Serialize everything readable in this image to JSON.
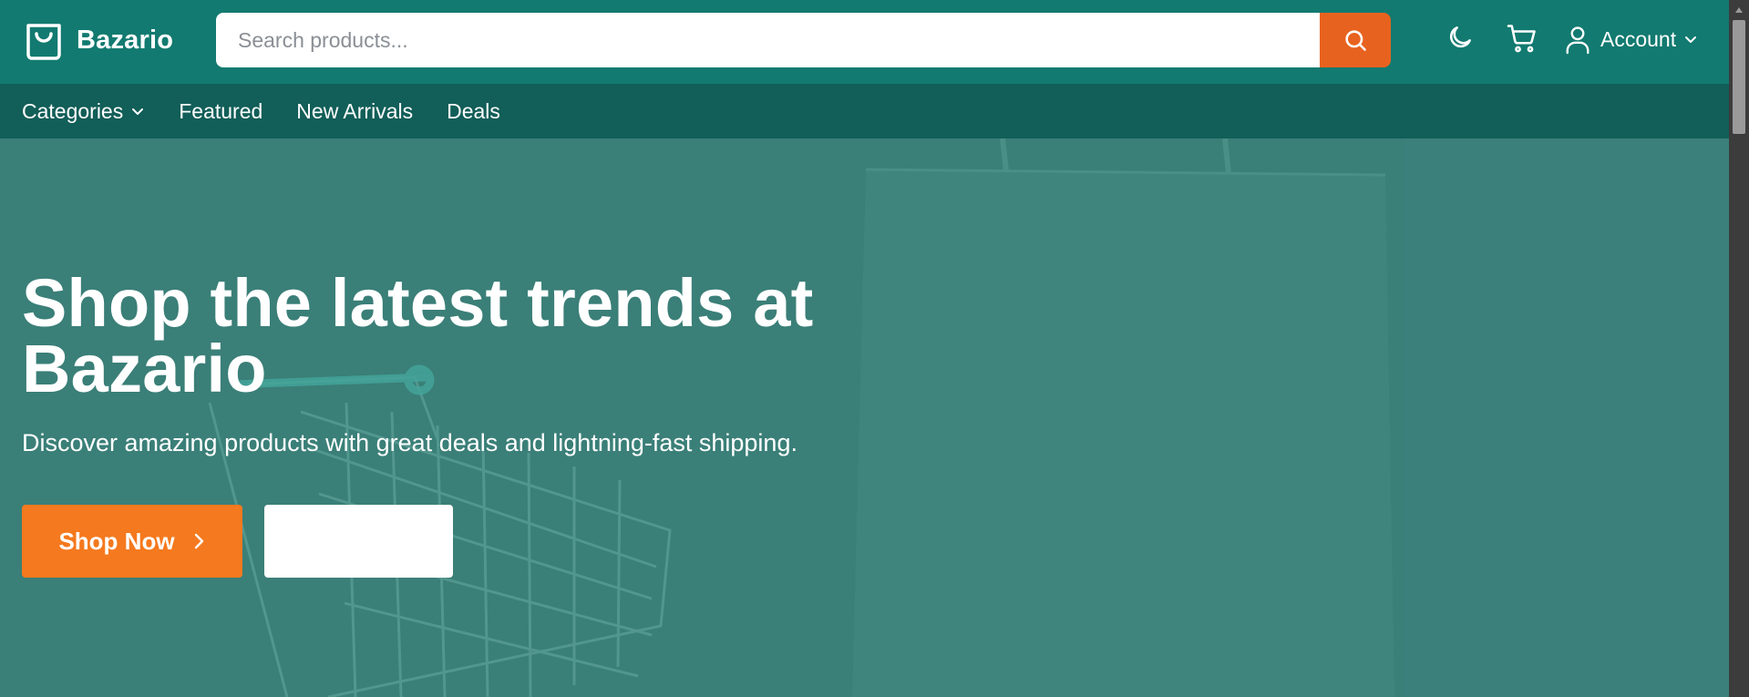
{
  "brand": {
    "name": "Bazario",
    "icon": "shopping-bag-icon"
  },
  "search": {
    "placeholder": "Search products...",
    "value": "",
    "button_icon": "search-icon"
  },
  "header_icons": {
    "theme_toggle": "moon-icon",
    "cart": "cart-icon",
    "account_icon": "user-icon"
  },
  "account": {
    "label": "Account"
  },
  "nav": {
    "items": [
      {
        "label": "Categories",
        "has_dropdown": true
      },
      {
        "label": "Featured"
      },
      {
        "label": "New Arrivals"
      },
      {
        "label": "Deals"
      }
    ]
  },
  "hero": {
    "title": "Shop the latest trends at Bazario",
    "subtitle": "Discover amazing products with great deals and lightning-fast shipping.",
    "primary_button": "Shop Now",
    "secondary_button": ""
  },
  "colors": {
    "header": "#127a70",
    "nav": "#125e58",
    "accent": "#e8621f",
    "cta": "#f5791e",
    "hero": "#3a7f78"
  }
}
